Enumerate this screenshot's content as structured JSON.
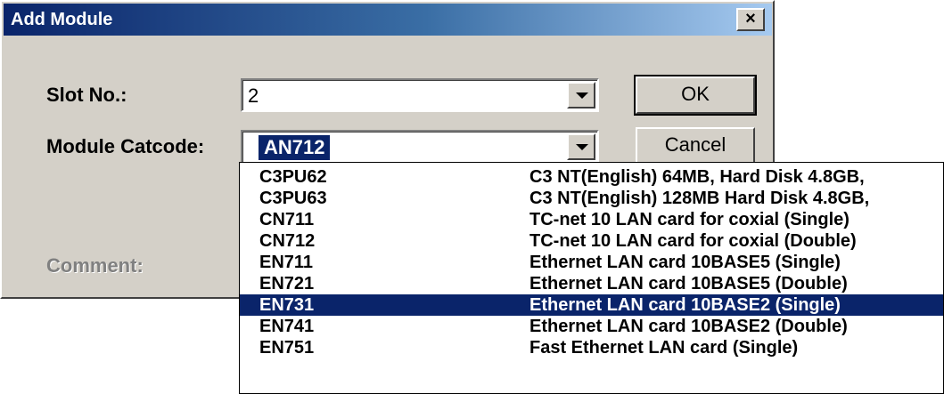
{
  "dialog": {
    "title": "Add Module",
    "close_glyph": "×",
    "slot_label": "Slot No.:",
    "slot_value": "2",
    "catcode_label": "Module Catcode:",
    "catcode_value": "AN712",
    "comment_label": "Comment:",
    "ok_label": "OK",
    "cancel_label": "Cancel"
  },
  "dropdown": {
    "selected_index": 6,
    "items": [
      {
        "code": "C3PU62",
        "desc": "C3 NT(English) 64MB, Hard Disk 4.8GB,"
      },
      {
        "code": "C3PU63",
        "desc": "C3 NT(English) 128MB Hard Disk 4.8GB,"
      },
      {
        "code": "CN711",
        "desc": "TC-net 10 LAN card  for coxial (Single)"
      },
      {
        "code": "CN712",
        "desc": "TC-net 10 LAN card  for coxial (Double)"
      },
      {
        "code": "EN711",
        "desc": "Ethernet LAN card 10BASE5 (Single)"
      },
      {
        "code": "EN721",
        "desc": "Ethernet LAN card 10BASE5 (Double)"
      },
      {
        "code": "EN731",
        "desc": "Ethernet LAN card 10BASE2 (Single)"
      },
      {
        "code": "EN741",
        "desc": "Ethernet LAN card 10BASE2 (Double)"
      },
      {
        "code": "EN751",
        "desc": "Fast Ethernet LAN card (Single)"
      }
    ]
  },
  "colors": {
    "title_bar": "#0a246a",
    "face": "#d4d0c8",
    "highlight": "#0a246a"
  },
  "icons": {
    "close": "close-icon",
    "dropdown_arrow": "chevron-down-icon"
  }
}
